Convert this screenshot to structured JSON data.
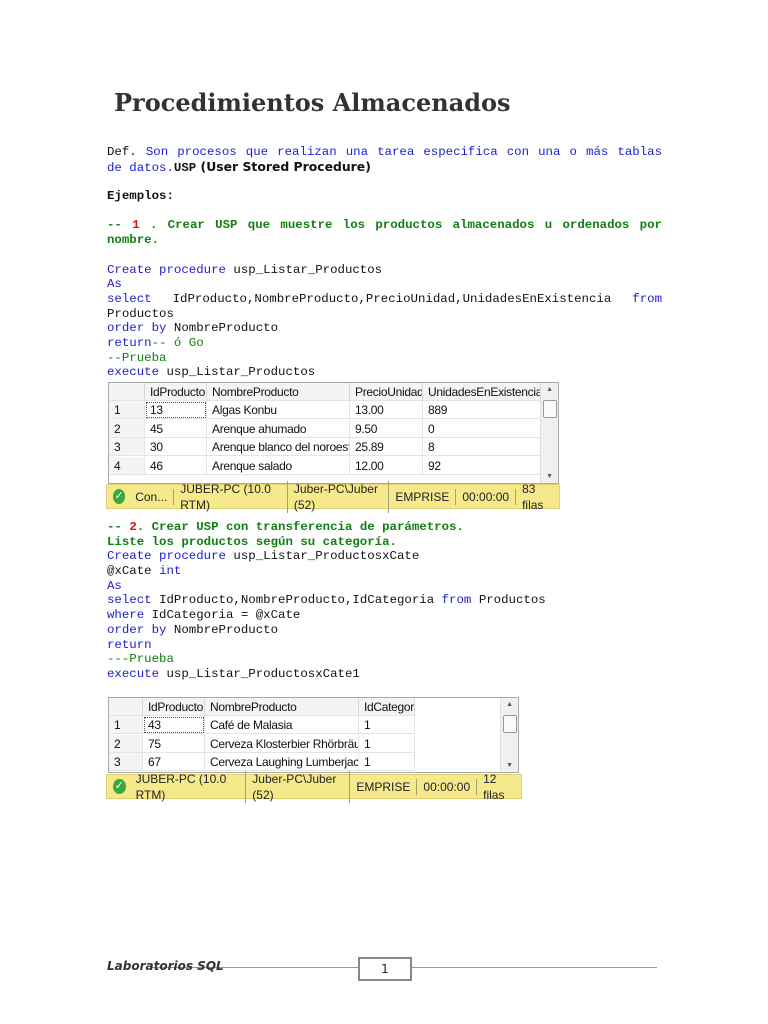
{
  "title": "Procedimientos Almacenados",
  "intro": [
    {
      "just": true,
      "segs": [
        {
          "t": "Def.",
          "k": "pl"
        },
        {
          "t": "Son procesos que realizan una tarea especifica con una o más tablas",
          "k": "kw"
        }
      ]
    },
    {
      "segs": [
        {
          "t": "de datos.",
          "k": "kw"
        },
        {
          "t": "USP",
          "k": "bd"
        },
        {
          "t": " (User Stored Procedure)",
          "k": "sans"
        }
      ]
    },
    {
      "segs": [
        {
          "t": " ",
          "k": "pl"
        }
      ]
    },
    {
      "segs": [
        {
          "t": "Ejemplos:",
          "k": "bd"
        }
      ]
    },
    {
      "segs": [
        {
          "t": " ",
          "k": "pl"
        }
      ]
    },
    {
      "just": true,
      "segs": [
        {
          "t": "--",
          "k": "cmb"
        },
        {
          "t": "1",
          "k": "num"
        },
        {
          "t": ". Crear USP que muestre los productos almacenados u ordenados por",
          "k": "cmb"
        }
      ]
    },
    {
      "segs": [
        {
          "t": "nombre.",
          "k": "cmb"
        }
      ]
    },
    {
      "segs": [
        {
          "t": " ",
          "k": "pl"
        }
      ]
    },
    {
      "segs": [
        {
          "t": "Create procedure ",
          "k": "kw"
        },
        {
          "t": "usp_Listar_Productos",
          "k": "pl"
        }
      ]
    },
    {
      "segs": [
        {
          "t": "As",
          "k": "kw"
        }
      ]
    },
    {
      "just": true,
      "segs": [
        {
          "t": "select",
          "k": "kw"
        },
        {
          "t": "IdProducto,NombreProducto,PrecioUnidad,UnidadesEnExistencia",
          "k": "pl"
        },
        {
          "t": "from",
          "k": "kw"
        }
      ]
    },
    {
      "segs": [
        {
          "t": "Productos",
          "k": "pl"
        }
      ]
    },
    {
      "segs": [
        {
          "t": "order by ",
          "k": "kw"
        },
        {
          "t": "NombreProducto",
          "k": "pl"
        }
      ]
    },
    {
      "segs": [
        {
          "t": "return",
          "k": "kw"
        },
        {
          "t": "-- ó Go",
          "k": "cm"
        }
      ]
    },
    {
      "segs": [
        {
          "t": "--Prueba",
          "k": "cm"
        }
      ]
    },
    {
      "segs": [
        {
          "t": "execute ",
          "k": "kw"
        },
        {
          "t": "usp_Listar_Productos",
          "k": "pl"
        }
      ]
    }
  ],
  "table1": {
    "columns": [
      "",
      "IdProducto",
      "NombreProducto",
      "PrecioUnidad",
      "UnidadesEnExistencia"
    ],
    "rows": [
      [
        "1",
        "13",
        "Algas Konbu",
        "13.00",
        "889"
      ],
      [
        "2",
        "45",
        "Arenque ahumado",
        "9.50",
        "0"
      ],
      [
        "3",
        "30",
        "Arenque blanco del noroeste",
        "25.89",
        "8"
      ],
      [
        "4",
        "46",
        "Arenque salado",
        "12.00",
        "92"
      ]
    ],
    "status": [
      "Con...",
      "JUBER-PC (10.0 RTM)",
      "Juber-PC\\Juber (52)",
      "EMPRISE",
      "00:00:00",
      "83 filas"
    ]
  },
  "example2": [
    {
      "segs": [
        {
          "t": "-- ",
          "k": "cmb"
        },
        {
          "t": "2",
          "k": "num"
        },
        {
          "t": ". Crear USP con transferencia de parámetros.",
          "k": "cmb"
        }
      ]
    },
    {
      "segs": [
        {
          "t": "Liste los productos según su categoría.",
          "k": "cmb"
        }
      ]
    },
    {
      "segs": [
        {
          "t": "Create procedure ",
          "k": "kw"
        },
        {
          "t": "usp_Listar_ProductosxCate",
          "k": "pl"
        }
      ]
    },
    {
      "segs": [
        {
          "t": "@xCate ",
          "k": "pl"
        },
        {
          "t": "int",
          "k": "kw"
        }
      ]
    },
    {
      "segs": [
        {
          "t": "As",
          "k": "kw"
        }
      ]
    },
    {
      "segs": [
        {
          "t": "select ",
          "k": "kw"
        },
        {
          "t": "IdProducto,NombreProducto,IdCategoria ",
          "k": "pl"
        },
        {
          "t": "from ",
          "k": "kw"
        },
        {
          "t": "Productos",
          "k": "pl"
        }
      ]
    },
    {
      "segs": [
        {
          "t": "where ",
          "k": "kw"
        },
        {
          "t": "IdCategoria = @xCate",
          "k": "pl"
        }
      ]
    },
    {
      "segs": [
        {
          "t": "order by ",
          "k": "kw"
        },
        {
          "t": "NombreProducto",
          "k": "pl"
        }
      ]
    },
    {
      "segs": [
        {
          "t": "return",
          "k": "kw"
        }
      ]
    },
    {
      "segs": [
        {
          "t": "---Prueba",
          "k": "cm"
        }
      ]
    },
    {
      "segs": [
        {
          "t": "execute ",
          "k": "kw"
        },
        {
          "t": "usp_Listar_ProductosxCate1",
          "k": "pl"
        }
      ]
    }
  ],
  "table2": {
    "columns": [
      "",
      "IdProducto",
      "NombreProducto",
      "IdCategoría"
    ],
    "rows": [
      [
        "1",
        "43",
        "Café de Malasia",
        "1"
      ],
      [
        "2",
        "75",
        "Cerveza Klosterbier Rhörbräu",
        "1"
      ],
      [
        "3",
        "67",
        "Cerveza Laughing Lumberjack",
        "1"
      ]
    ],
    "status": [
      "JUBER-PC (10.0 RTM)",
      "Juber-PC\\Juber (52)",
      "EMPRISE",
      "00:00:00",
      "12 filas"
    ]
  },
  "footer": {
    "label": "Laboratorios SQL",
    "page": "1"
  }
}
